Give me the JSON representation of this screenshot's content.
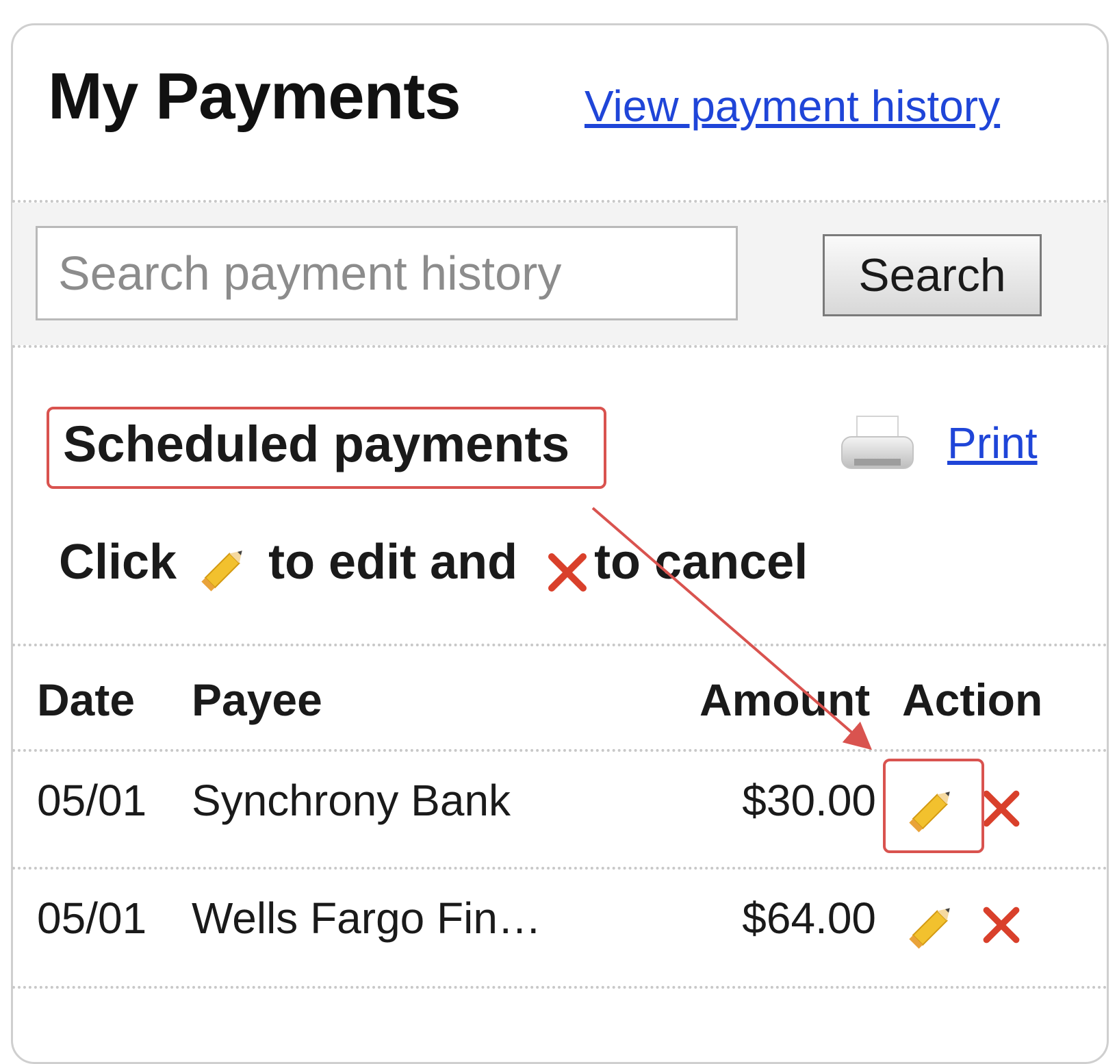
{
  "header": {
    "title": "My Payments",
    "history_link": "View payment history"
  },
  "search": {
    "placeholder": "Search payment history",
    "button_label": "Search"
  },
  "section": {
    "title": "Scheduled payments",
    "print_label": "Print"
  },
  "instructions": {
    "part1": "Click",
    "part2": "to edit and",
    "part3": "to cancel"
  },
  "table": {
    "columns": {
      "date": "Date",
      "payee": "Payee",
      "amount": "Amount",
      "action": "Action"
    },
    "rows": [
      {
        "date": "05/01",
        "payee": "Synchrony Bank",
        "amount": "$30.00"
      },
      {
        "date": "05/01",
        "payee": "Wells Fargo Fin…",
        "amount": "$64.00"
      }
    ]
  },
  "icons": {
    "edit": "pencil-icon",
    "cancel": "close-icon",
    "print": "printer-icon"
  },
  "colors": {
    "link": "#1f45d8",
    "annotation": "#d9534f",
    "cancel": "#d9402b",
    "pencil": "#f2c12e"
  }
}
